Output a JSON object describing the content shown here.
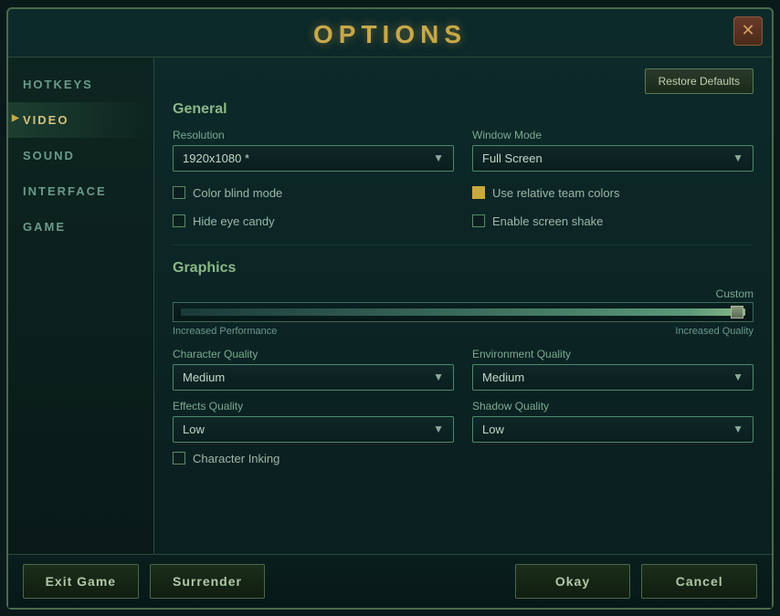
{
  "modal": {
    "title": "OPTIONS",
    "close_label": "✕"
  },
  "sidebar": {
    "items": [
      {
        "id": "hotkeys",
        "label": "HOTKEYS",
        "active": false
      },
      {
        "id": "video",
        "label": "VIDEO",
        "active": true
      },
      {
        "id": "sound",
        "label": "SOUND",
        "active": false
      },
      {
        "id": "interface",
        "label": "INTERFACE",
        "active": false
      },
      {
        "id": "game",
        "label": "GAME",
        "active": false
      }
    ]
  },
  "toolbar": {
    "restore_defaults_label": "Restore Defaults"
  },
  "general": {
    "section_title": "General",
    "resolution_label": "Resolution",
    "resolution_value": "1920x1080 *",
    "window_mode_label": "Window Mode",
    "window_mode_value": "Full Screen",
    "checkboxes": [
      {
        "id": "color-blind",
        "label": "Color blind mode",
        "checked": false
      },
      {
        "id": "use-relative-team",
        "label": "Use relative team colors",
        "checked_yellow": true
      },
      {
        "id": "hide-eye-candy",
        "label": "Hide eye candy",
        "checked": false
      },
      {
        "id": "enable-screen-shake",
        "label": "Enable screen shake",
        "checked": false
      }
    ]
  },
  "graphics": {
    "section_title": "Graphics",
    "preset_label": "Custom",
    "slider_left_label": "Increased Performance",
    "slider_right_label": "Increased Quality",
    "character_quality_label": "Character Quality",
    "character_quality_value": "Medium",
    "environment_quality_label": "Environment Quality",
    "environment_quality_value": "Medium",
    "effects_quality_label": "Effects Quality",
    "effects_quality_value": "Low",
    "shadow_quality_label": "Shadow Quality",
    "shadow_quality_value": "Low",
    "character_inking_label": "Character Inking",
    "character_inking_checked": false
  },
  "footer": {
    "exit_game_label": "Exit Game",
    "surrender_label": "Surrender",
    "okay_label": "Okay",
    "cancel_label": "Cancel"
  }
}
